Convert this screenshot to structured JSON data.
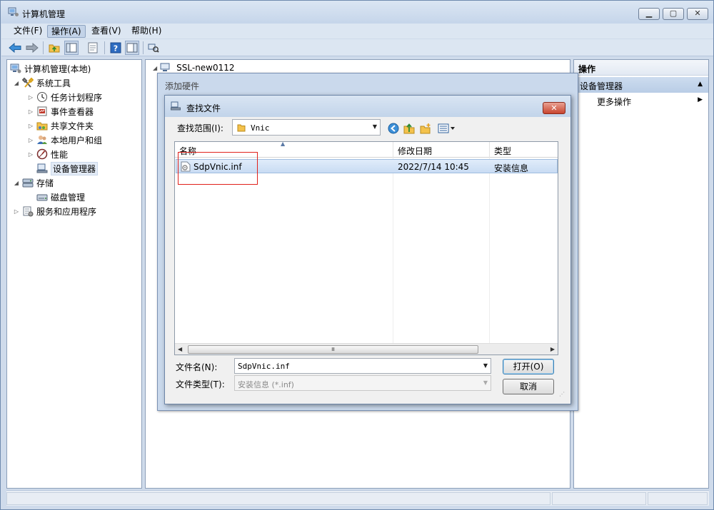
{
  "window": {
    "title": "计算机管理",
    "controls": {
      "minimize": "▁",
      "maximize": "▢",
      "close": "✕"
    }
  },
  "menu": [
    "文件(F)",
    "操作(A)",
    "查看(V)",
    "帮助(H)"
  ],
  "toolbar_icons": [
    "back-arrow-icon",
    "forward-arrow-icon",
    "up-folder-icon",
    "show-hide-tree-icon",
    "properties-icon",
    "help-icon",
    "show-hide-action-pane-icon",
    "scan-hardware-icon"
  ],
  "tree": {
    "root": "计算机管理(本地)",
    "system_tools": "系统工具",
    "task_scheduler": "任务计划程序",
    "event_viewer": "事件查看器",
    "shared_folders": "共享文件夹",
    "local_users": "本地用户和组",
    "performance": "性能",
    "device_manager": "设备管理器",
    "storage": "存储",
    "disk_management": "磁盘管理",
    "services_apps": "服务和应用程序"
  },
  "center": {
    "computer_name": "SSL-new0112"
  },
  "actions": {
    "header": "操作",
    "section": "设备管理器",
    "more": "更多操作"
  },
  "add_hardware": {
    "title": "添加硬件"
  },
  "find_file": {
    "title": "查找文件",
    "look_in_label": "查找范围(I):",
    "look_in_value": "Vnic",
    "columns": {
      "name": "名称",
      "date": "修改日期",
      "type": "类型"
    },
    "files": [
      {
        "name": "SdpVnic.inf",
        "date": "2022/7/14 10:45",
        "type": "安装信息"
      }
    ],
    "scroll_grip": "Ⅲ",
    "file_name_label": "文件名(N):",
    "file_name_value": "SdpVnic.inf",
    "file_type_label": "文件类型(T):",
    "file_type_value": "安装信息 (*.inf)",
    "open_button": "打开(O)",
    "cancel_button": "取消"
  },
  "colors": {
    "selection": "#cfe0f5",
    "highlight_box": "#e0201b",
    "frame": "#cfdbeb"
  }
}
